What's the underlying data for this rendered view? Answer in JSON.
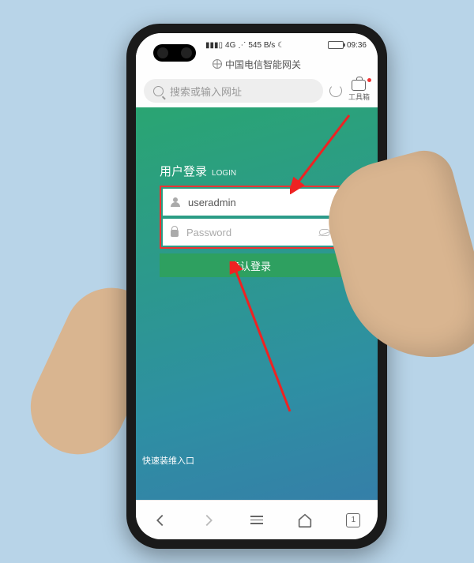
{
  "status_bar": {
    "network_label": "4G",
    "signal_speed": "545 B/s",
    "time": "09:36"
  },
  "page": {
    "title": "中国电信智能网关"
  },
  "address_bar": {
    "placeholder": "搜索或输入网址"
  },
  "toolbox": {
    "label": "工具箱"
  },
  "login": {
    "title_cn": "用户登录",
    "title_en": "LOGIN",
    "username_value": "useradmin",
    "password_placeholder": "Password",
    "submit_label": "确认登录"
  },
  "fast_link": {
    "label": "快速装维入口"
  },
  "nav": {
    "tab_count": "1"
  }
}
